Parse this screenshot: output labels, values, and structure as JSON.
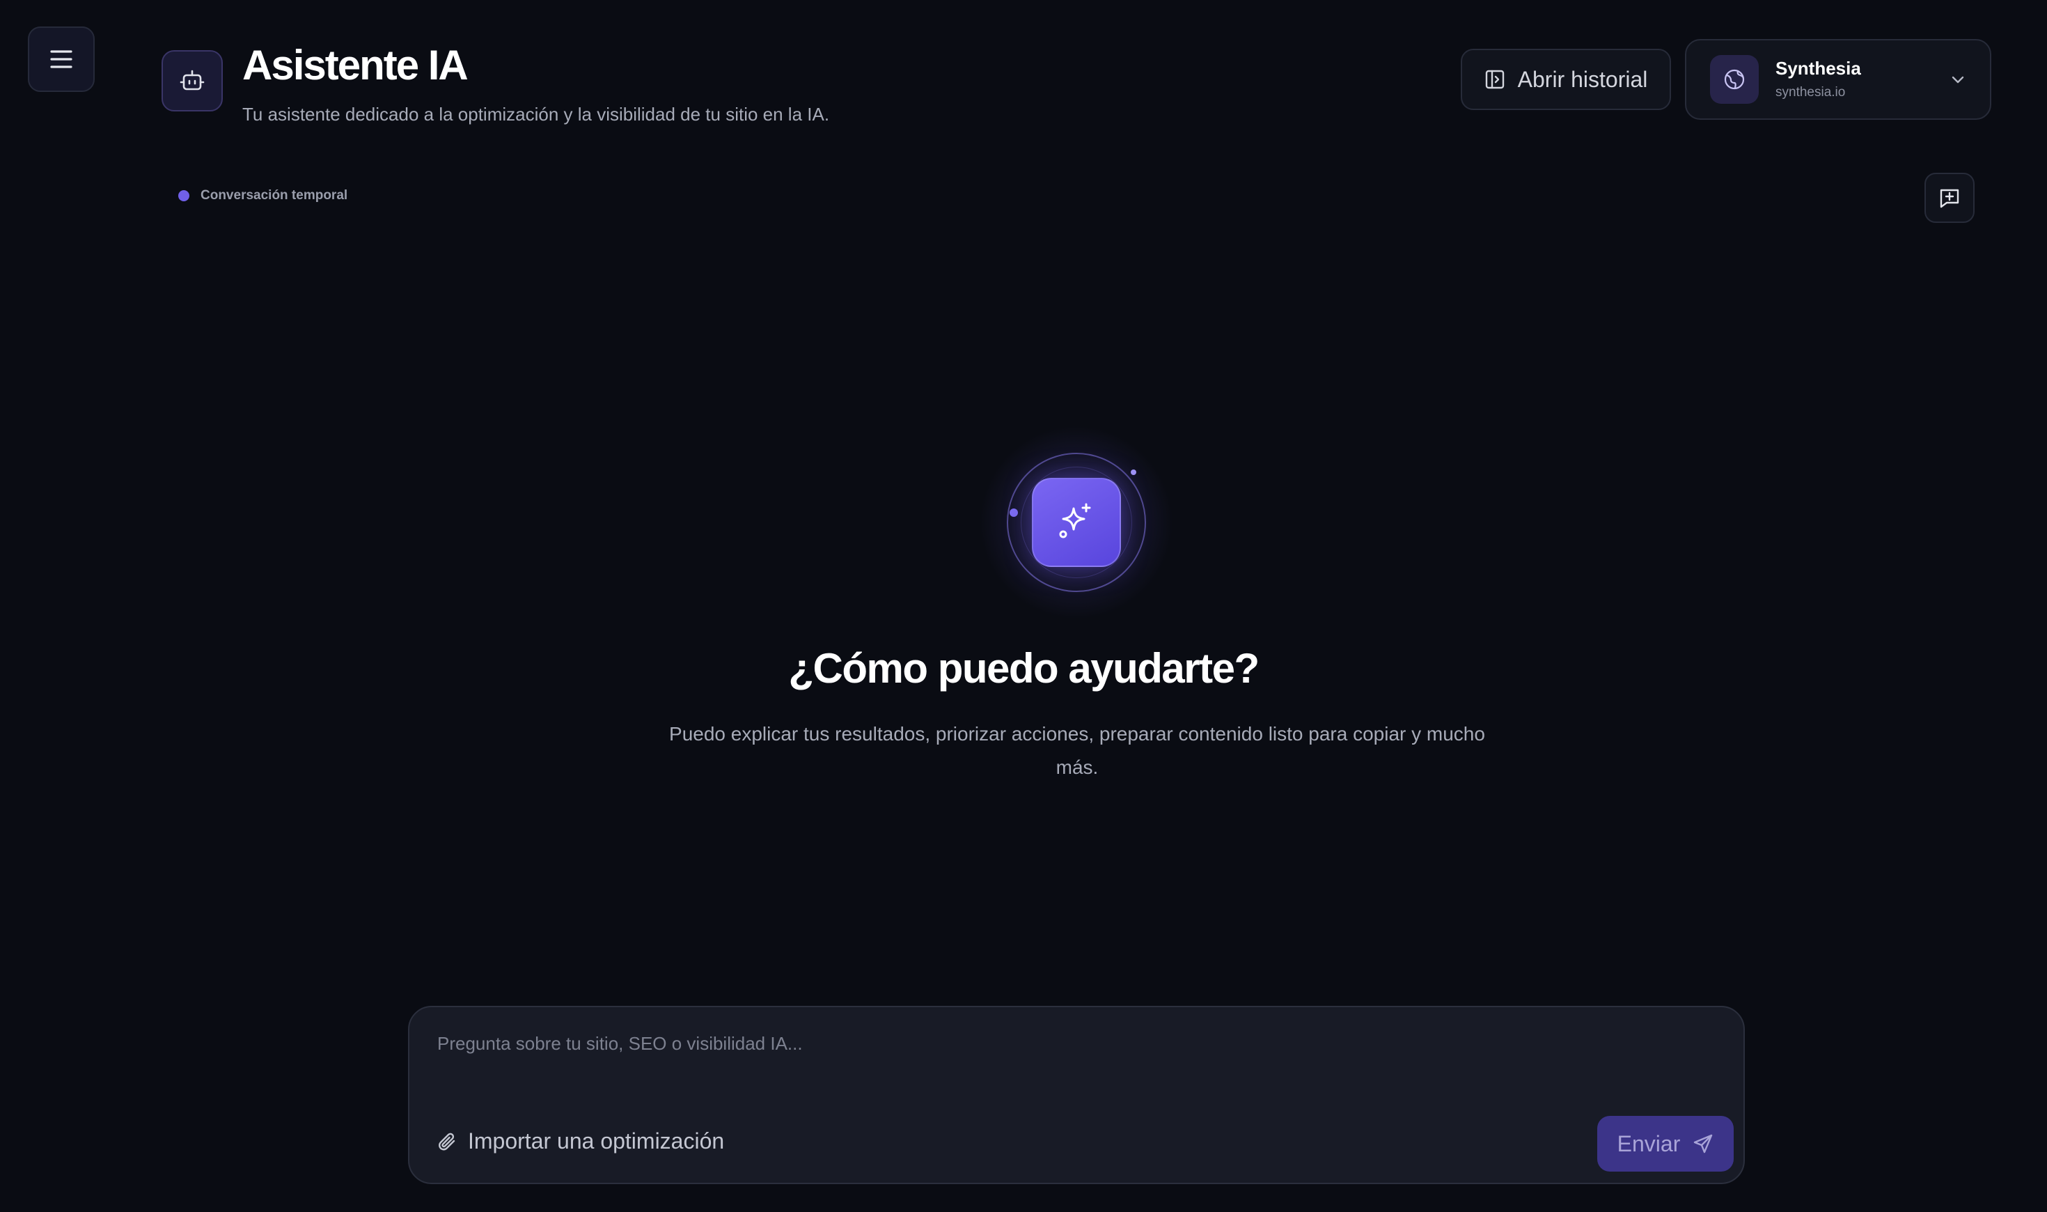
{
  "header": {
    "title": "Asistente IA",
    "subtitle": "Tu asistente dedicado a la optimización y la visibilidad de tu sitio en la IA.",
    "history_label": "Abrir historial"
  },
  "site": {
    "name": "Synthesia",
    "domain": "synthesia.io"
  },
  "conversation": {
    "status_label": "Conversación temporal"
  },
  "hero": {
    "title": "¿Cómo puedo ayudarte?",
    "description": "Puedo explicar tus resultados, priorizar acciones, preparar contenido listo para copiar y mucho más."
  },
  "composer": {
    "placeholder": "Pregunta sobre tu sitio, SEO o visibilidad IA...",
    "import_label": "Importar una optimización",
    "send_label": "Enviar"
  },
  "colors": {
    "background": "#0a0c13",
    "accent": "#6b57e8",
    "send_button": "#3c3489"
  },
  "icons": {
    "menu": "menu-icon",
    "header": "robot-icon",
    "history": "sidebar-panel-icon",
    "site": "globe-icon",
    "site_chevron": "chevron-down-icon",
    "new_chat": "message-plus-icon",
    "hero": "sparkles-icon",
    "import": "paperclip-icon",
    "send": "send-icon"
  }
}
